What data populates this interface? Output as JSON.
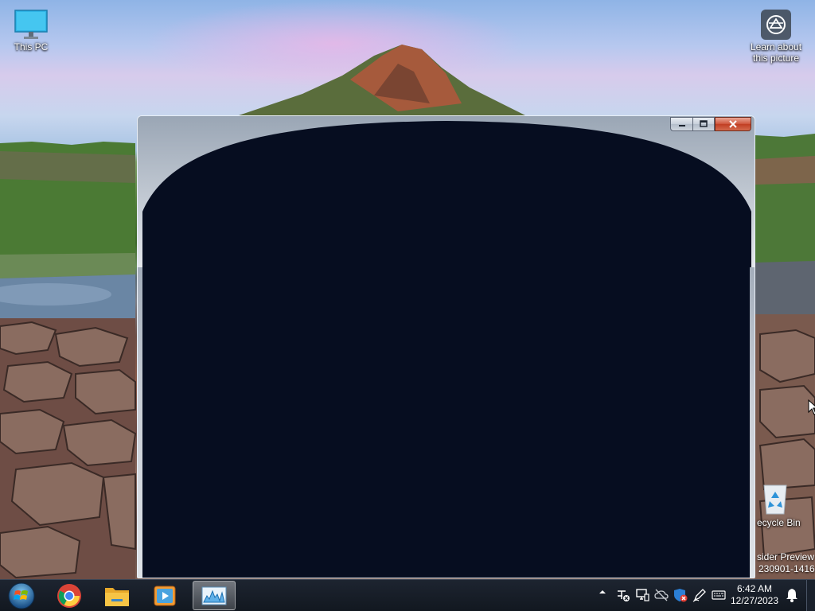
{
  "desktop": {
    "icons": [
      {
        "label": "This PC",
        "icon": "monitor-icon"
      },
      {
        "label": "Learn about this picture",
        "icon": "camera-icon"
      },
      {
        "label": "ecycle Bin",
        "icon": "recycle-bin-icon"
      }
    ],
    "watermark": {
      "line1": "sider Preview",
      "line2": "230901-1416"
    }
  },
  "window": {
    "caption_buttons": [
      "minimize-icon",
      "maximize-icon",
      "close-icon"
    ],
    "body_color": "#060d20"
  },
  "taskbar": {
    "start_icon": "windows-start-icon",
    "pinned": [
      "chrome-icon",
      "file-explorer-icon",
      "media-player-icon",
      "resource-monitor-icon"
    ],
    "active_item": "resource-monitor-icon",
    "tray_icons": [
      "chevron-up-icon",
      "action-center-icon",
      "network-icon",
      "cloud-offline-icon",
      "defender-icon",
      "pen-icon",
      "keyboard-icon"
    ],
    "clock": {
      "time": "6:42 AM",
      "date": "12/27/2023"
    },
    "notification_icon": "bell-icon"
  }
}
